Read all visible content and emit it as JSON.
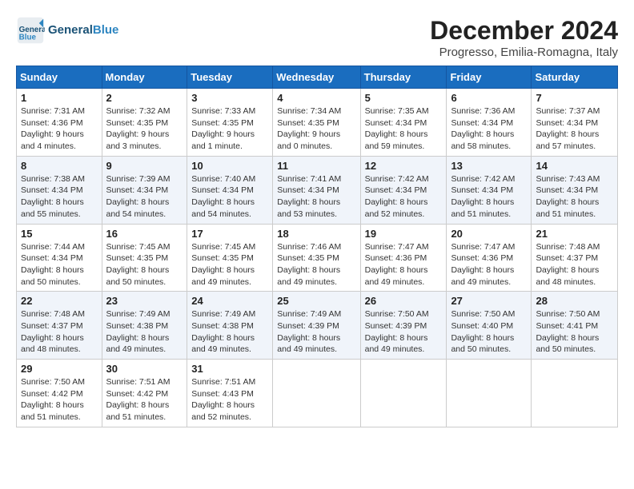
{
  "header": {
    "logo_text_general": "General",
    "logo_text_blue": "Blue",
    "month_title": "December 2024",
    "subtitle": "Progresso, Emilia-Romagna, Italy"
  },
  "weekdays": [
    "Sunday",
    "Monday",
    "Tuesday",
    "Wednesday",
    "Thursday",
    "Friday",
    "Saturday"
  ],
  "weeks": [
    [
      {
        "day": "1",
        "info": "Sunrise: 7:31 AM\nSunset: 4:36 PM\nDaylight: 9 hours\nand 4 minutes."
      },
      {
        "day": "2",
        "info": "Sunrise: 7:32 AM\nSunset: 4:35 PM\nDaylight: 9 hours\nand 3 minutes."
      },
      {
        "day": "3",
        "info": "Sunrise: 7:33 AM\nSunset: 4:35 PM\nDaylight: 9 hours\nand 1 minute."
      },
      {
        "day": "4",
        "info": "Sunrise: 7:34 AM\nSunset: 4:35 PM\nDaylight: 9 hours\nand 0 minutes."
      },
      {
        "day": "5",
        "info": "Sunrise: 7:35 AM\nSunset: 4:34 PM\nDaylight: 8 hours\nand 59 minutes."
      },
      {
        "day": "6",
        "info": "Sunrise: 7:36 AM\nSunset: 4:34 PM\nDaylight: 8 hours\nand 58 minutes."
      },
      {
        "day": "7",
        "info": "Sunrise: 7:37 AM\nSunset: 4:34 PM\nDaylight: 8 hours\nand 57 minutes."
      }
    ],
    [
      {
        "day": "8",
        "info": "Sunrise: 7:38 AM\nSunset: 4:34 PM\nDaylight: 8 hours\nand 55 minutes."
      },
      {
        "day": "9",
        "info": "Sunrise: 7:39 AM\nSunset: 4:34 PM\nDaylight: 8 hours\nand 54 minutes."
      },
      {
        "day": "10",
        "info": "Sunrise: 7:40 AM\nSunset: 4:34 PM\nDaylight: 8 hours\nand 54 minutes."
      },
      {
        "day": "11",
        "info": "Sunrise: 7:41 AM\nSunset: 4:34 PM\nDaylight: 8 hours\nand 53 minutes."
      },
      {
        "day": "12",
        "info": "Sunrise: 7:42 AM\nSunset: 4:34 PM\nDaylight: 8 hours\nand 52 minutes."
      },
      {
        "day": "13",
        "info": "Sunrise: 7:42 AM\nSunset: 4:34 PM\nDaylight: 8 hours\nand 51 minutes."
      },
      {
        "day": "14",
        "info": "Sunrise: 7:43 AM\nSunset: 4:34 PM\nDaylight: 8 hours\nand 51 minutes."
      }
    ],
    [
      {
        "day": "15",
        "info": "Sunrise: 7:44 AM\nSunset: 4:34 PM\nDaylight: 8 hours\nand 50 minutes."
      },
      {
        "day": "16",
        "info": "Sunrise: 7:45 AM\nSunset: 4:35 PM\nDaylight: 8 hours\nand 50 minutes."
      },
      {
        "day": "17",
        "info": "Sunrise: 7:45 AM\nSunset: 4:35 PM\nDaylight: 8 hours\nand 49 minutes."
      },
      {
        "day": "18",
        "info": "Sunrise: 7:46 AM\nSunset: 4:35 PM\nDaylight: 8 hours\nand 49 minutes."
      },
      {
        "day": "19",
        "info": "Sunrise: 7:47 AM\nSunset: 4:36 PM\nDaylight: 8 hours\nand 49 minutes."
      },
      {
        "day": "20",
        "info": "Sunrise: 7:47 AM\nSunset: 4:36 PM\nDaylight: 8 hours\nand 49 minutes."
      },
      {
        "day": "21",
        "info": "Sunrise: 7:48 AM\nSunset: 4:37 PM\nDaylight: 8 hours\nand 48 minutes."
      }
    ],
    [
      {
        "day": "22",
        "info": "Sunrise: 7:48 AM\nSunset: 4:37 PM\nDaylight: 8 hours\nand 48 minutes."
      },
      {
        "day": "23",
        "info": "Sunrise: 7:49 AM\nSunset: 4:38 PM\nDaylight: 8 hours\nand 49 minutes."
      },
      {
        "day": "24",
        "info": "Sunrise: 7:49 AM\nSunset: 4:38 PM\nDaylight: 8 hours\nand 49 minutes."
      },
      {
        "day": "25",
        "info": "Sunrise: 7:49 AM\nSunset: 4:39 PM\nDaylight: 8 hours\nand 49 minutes."
      },
      {
        "day": "26",
        "info": "Sunrise: 7:50 AM\nSunset: 4:39 PM\nDaylight: 8 hours\nand 49 minutes."
      },
      {
        "day": "27",
        "info": "Sunrise: 7:50 AM\nSunset: 4:40 PM\nDaylight: 8 hours\nand 50 minutes."
      },
      {
        "day": "28",
        "info": "Sunrise: 7:50 AM\nSunset: 4:41 PM\nDaylight: 8 hours\nand 50 minutes."
      }
    ],
    [
      {
        "day": "29",
        "info": "Sunrise: 7:50 AM\nSunset: 4:42 PM\nDaylight: 8 hours\nand 51 minutes."
      },
      {
        "day": "30",
        "info": "Sunrise: 7:51 AM\nSunset: 4:42 PM\nDaylight: 8 hours\nand 51 minutes."
      },
      {
        "day": "31",
        "info": "Sunrise: 7:51 AM\nSunset: 4:43 PM\nDaylight: 8 hours\nand 52 minutes."
      },
      {
        "day": "",
        "info": ""
      },
      {
        "day": "",
        "info": ""
      },
      {
        "day": "",
        "info": ""
      },
      {
        "day": "",
        "info": ""
      }
    ]
  ]
}
